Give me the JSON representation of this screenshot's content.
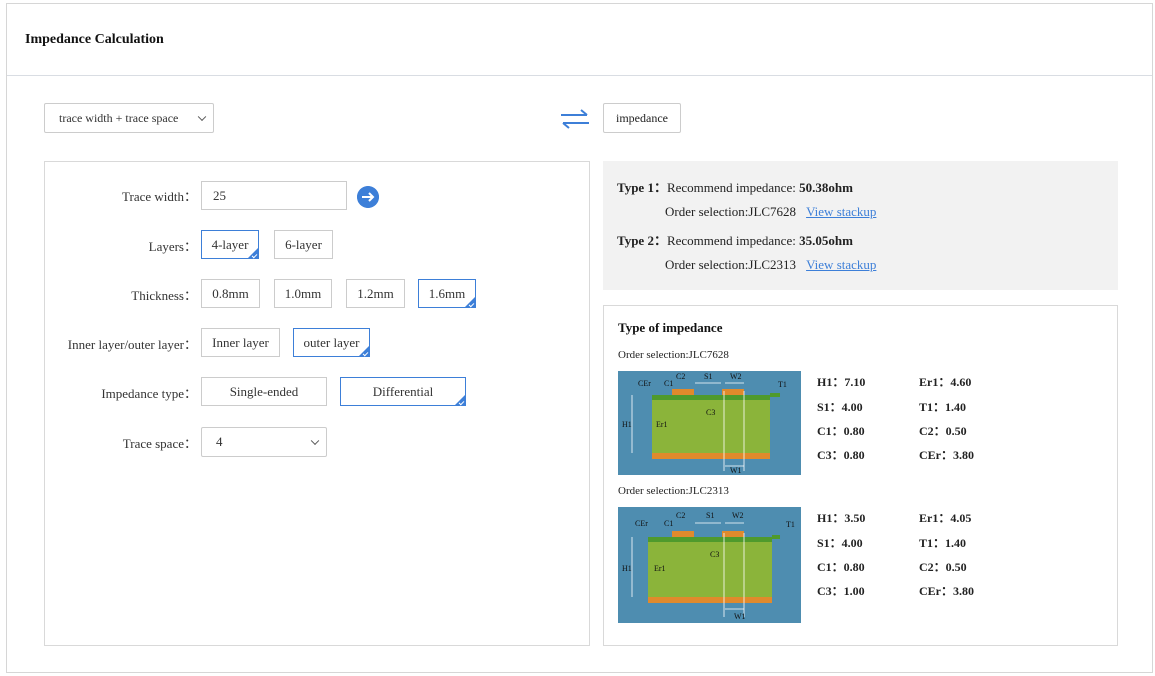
{
  "header": {
    "title": "Impedance Calculation"
  },
  "mode_select": {
    "value": "trace width + trace space"
  },
  "target_label": "impedance",
  "form": {
    "trace_width": {
      "label": "Trace width：",
      "value": "25"
    },
    "layers": {
      "label": "Layers：",
      "options": [
        "4-layer",
        "6-layer"
      ],
      "selected": "4-layer"
    },
    "thickness": {
      "label": "Thickness：",
      "options": [
        "0.8mm",
        "1.0mm",
        "1.2mm",
        "1.6mm"
      ],
      "selected": "1.6mm"
    },
    "layer_side": {
      "label": "Inner layer/outer layer：",
      "options": [
        "Inner layer",
        "outer layer"
      ],
      "selected": "outer layer"
    },
    "impedance_type": {
      "label": "Impedance type：",
      "options": [
        "Single-ended",
        "Differential"
      ],
      "selected": "Differential"
    },
    "trace_space": {
      "label": "Trace space：",
      "value": "4"
    }
  },
  "results": [
    {
      "type_label": "Type 1：",
      "recommend_text": "Recommend impedance: ",
      "impedance": "50.38ohm",
      "order_selection": "Order selection:JLC7628",
      "link": "View stackup"
    },
    {
      "type_label": "Type 2：",
      "recommend_text": "Recommend impedance: ",
      "impedance": "35.05ohm",
      "order_selection": "Order selection:JLC2313",
      "link": "View stackup"
    }
  ],
  "type_of_impedance": {
    "title": "Type of impedance",
    "stackups": [
      {
        "caption": "Order selection:JLC7628",
        "params": [
          [
            "H1：7.10",
            "Er1：4.60"
          ],
          [
            "S1：4.00",
            "T1：1.40"
          ],
          [
            "C1：0.80",
            "C2：0.50"
          ],
          [
            "C3：0.80",
            "CEr：3.80"
          ]
        ]
      },
      {
        "caption": "Order selection:JLC2313",
        "params": [
          [
            "H1：3.50",
            "Er1：4.05"
          ],
          [
            "S1：4.00",
            "T1：1.40"
          ],
          [
            "C1：0.80",
            "C2：0.50"
          ],
          [
            "C3：1.00",
            "CEr：3.80"
          ]
        ]
      }
    ],
    "diagram_labels": {
      "cer": "CEr",
      "c1": "C1",
      "c2": "C2",
      "s1": "S1",
      "w2": "W2",
      "t1": "T1",
      "c3": "C3",
      "h1": "H1",
      "er1": "Er1",
      "w1": "W1"
    }
  },
  "colors": {
    "accent": "#3d7fd8",
    "diagram_bg": "#4e8db0",
    "board": "#8bb43a",
    "copper": "#e08a2c"
  }
}
